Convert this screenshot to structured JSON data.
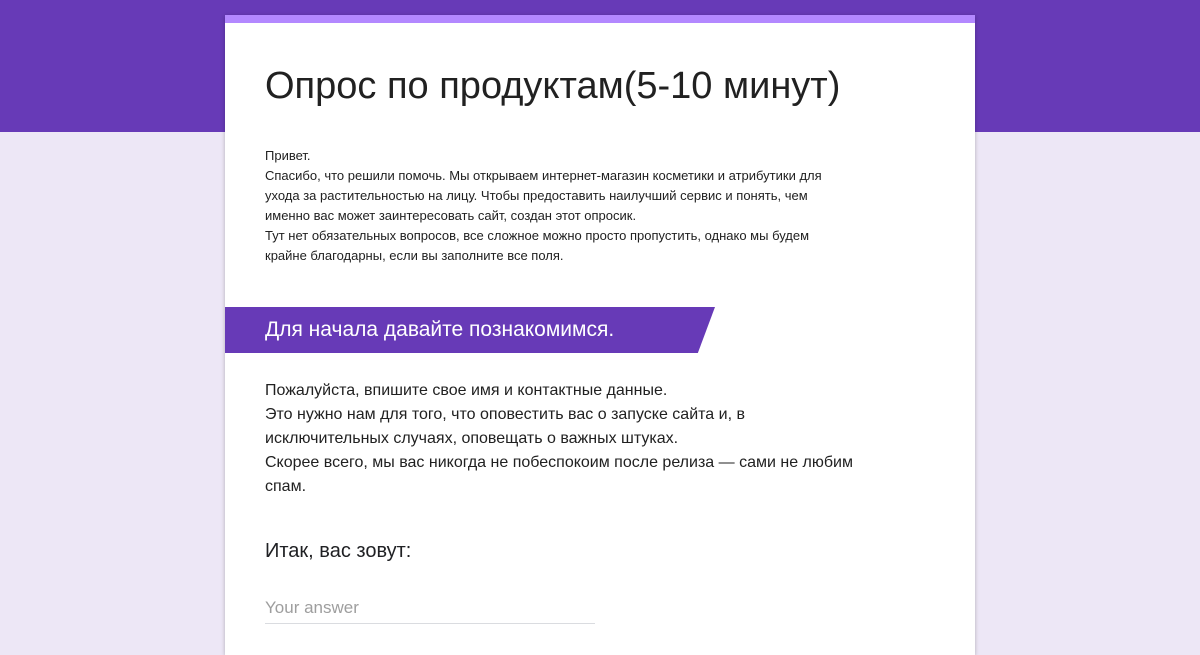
{
  "colors": {
    "header_band": "#673ab7",
    "page_background": "#ede7f6",
    "card_accent": "#b388ff",
    "section_banner": "#673ab7",
    "text": "#212121",
    "placeholder": "#9e9e9e"
  },
  "form": {
    "title": "Опрос по продуктам(5-10 минут)",
    "description_lines": [
      "Привет.",
      "Спасибо, что решили помочь. Мы открываем интернет-магазин косметики и атрибутики для",
      "ухода за растительностью на лицу. Чтобы предоставить наилучший сервис и понять, чем",
      "именно вас может заинтересовать сайт, создан этот опросик.",
      "Тут нет обязательных вопросов, все сложное можно просто пропустить, однако мы будем",
      "крайне благодарны, если вы заполните все поля."
    ]
  },
  "section": {
    "title": "Для начала давайте познакомимся.",
    "description_lines": [
      "Пожалуйста, впишите свое имя и контактные данные.",
      "Это нужно нам для того, что оповестить вас о запуске сайта и, в",
      "исключительных случаях, оповещать о важных штуках.",
      "Скорее всего, мы вас никогда не побеспокоим после релиза — сами не любим",
      "спам."
    ]
  },
  "question": {
    "title": "Итак, вас зовут:",
    "value": "",
    "placeholder": "Your answer"
  }
}
